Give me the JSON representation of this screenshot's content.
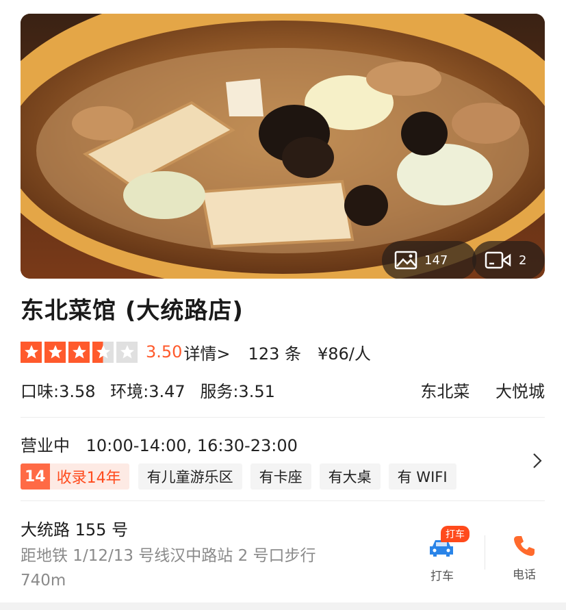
{
  "hero": {
    "photo_count": "147",
    "video_count": "2",
    "photo_icon": "image-icon",
    "video_icon": "video-camera-icon"
  },
  "restaurant": {
    "name": "东北菜馆 (大统路店)"
  },
  "rating": {
    "stars_value": 3.5,
    "stars_max": 5,
    "score": "3.50",
    "detail_link": "详情>",
    "review_count": "123 条",
    "price_per_person": "¥86/人"
  },
  "subscores": {
    "taste": "口味:3.58",
    "environment": "环境:3.47",
    "service": "服务:3.51"
  },
  "tags": {
    "cuisine": "东北菜",
    "area": "大悦城"
  },
  "hours": {
    "status": "营业中",
    "times": "10:00-14:00, 16:30-23:00"
  },
  "features": {
    "years_num": "14",
    "years_text": "收录14年",
    "items": [
      "有儿童游乐区",
      "有卡座",
      "有大桌",
      "有 WIFI"
    ]
  },
  "location": {
    "address": "大统路 155 号",
    "transit": "距地铁 1/12/13 号线汉中路站 2 号口步行 740m"
  },
  "actions": {
    "taxi_badge": "打车",
    "taxi_label": "打车",
    "phone_label": "电话"
  },
  "colors": {
    "accent": "#ff5a2c",
    "star_empty": "#e0e0e0",
    "taxi_blue": "#2a84e8",
    "phone_orange": "#ff6a2c"
  }
}
